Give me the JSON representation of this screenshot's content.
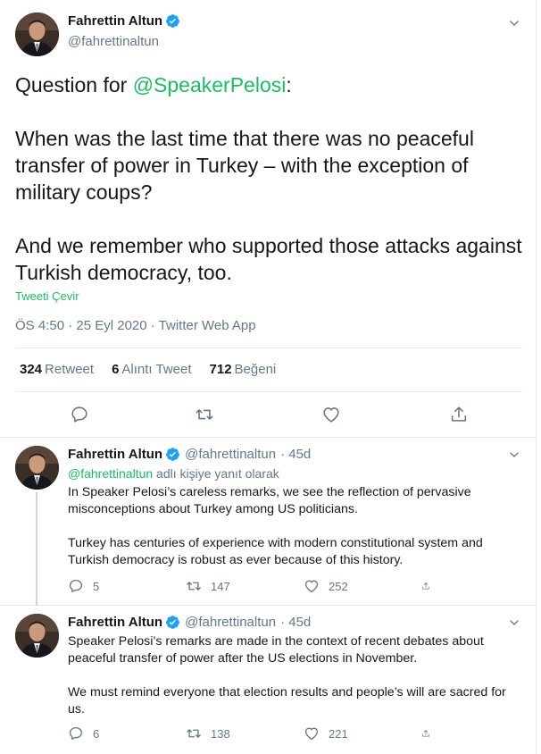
{
  "main_tweet": {
    "author_name": "Fahrettin Altun",
    "handle": "@fahrettinaltun",
    "text_prefix": "Question for ",
    "mention": "@SpeakerPelosi",
    "text_suffix": ":",
    "paragraph_2": "When was the last time that there was no peaceful transfer of power in Turkey – with the exception of military coups?",
    "paragraph_3": "And we remember who supported those attacks against Turkish democracy, too.",
    "translate_label": "Tweeti Çevir",
    "meta": "ÖS 4:50 · 25 Eyl 2020 · Twitter Web App",
    "stats": {
      "retweets_count": "324",
      "retweets_label": "Retweet",
      "quotes_count": "6",
      "quotes_label": "Alıntı Tweet",
      "likes_count": "712",
      "likes_label": "Beğeni"
    }
  },
  "replies": [
    {
      "author_name": "Fahrettin Altun",
      "handle": "@fahrettinaltun",
      "time": "· 45d",
      "reply_mention": "@fahrettinaltun",
      "reply_to_suffix": " adlı kişiye yanıt olarak",
      "paragraph_1": "In Speaker Pelosi’s careless remarks, we see the reflection of pervasive misconceptions about Turkey among US politicians.",
      "paragraph_2": "Turkey has centuries of experience with modern constitutional system and Turkish democracy is robust as ever because of this history.",
      "reply_count": "5",
      "retweet_count": "147",
      "like_count": "252"
    },
    {
      "author_name": "Fahrettin Altun",
      "handle": "@fahrettinaltun",
      "time": "· 45d",
      "paragraph_1": "Speaker Pelosi’s remarks are made in the context of recent debates about peaceful transfer of power after the US elections in November.",
      "paragraph_2": "We must remind everyone that election results and people’s will are sacred for us.",
      "reply_count": "6",
      "retweet_count": "138",
      "like_count": "221"
    }
  ],
  "colors": {
    "accent_blue": "#1da1f2",
    "translate_green": "#17bf63",
    "secondary_text": "#657786",
    "border": "#e6ecf0"
  },
  "icons": [
    "verified-badge-icon",
    "chevron-down-icon",
    "reply-icon",
    "retweet-icon",
    "like-icon",
    "share-icon"
  ]
}
